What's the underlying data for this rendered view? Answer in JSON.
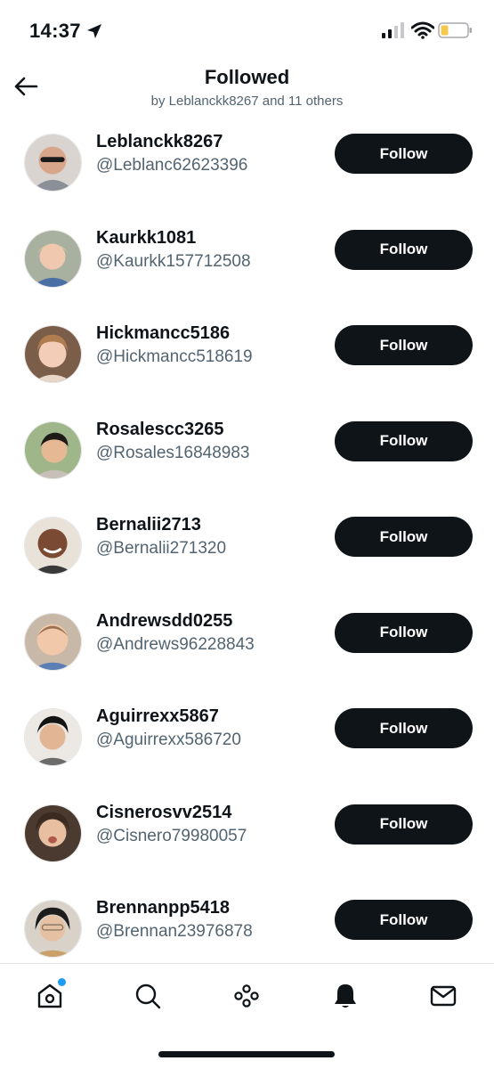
{
  "status_bar": {
    "time": "14:37",
    "icons": [
      "location-arrow-icon",
      "cellular-signal-icon",
      "wifi-icon",
      "battery-low-icon"
    ],
    "battery_color": "#f2c94c"
  },
  "header": {
    "back_icon": "arrow-left-icon",
    "title": "Followed",
    "subtitle": "by Leblanckk8267 and 11 others"
  },
  "users": [
    {
      "name": "Leblanckk8267",
      "handle": "@Leblanc62623396",
      "button": "Follow"
    },
    {
      "name": "Kaurkk1081",
      "handle": "@Kaurkk157712508",
      "button": "Follow"
    },
    {
      "name": "Hickmancc5186",
      "handle": "@Hickmancc518619",
      "button": "Follow"
    },
    {
      "name": "Rosalescc3265",
      "handle": "@Rosales16848983",
      "button": "Follow"
    },
    {
      "name": "Bernalii2713",
      "handle": "@Bernalii271320",
      "button": "Follow"
    },
    {
      "name": "Andrewsdd0255",
      "handle": "@Andrews96228843",
      "button": "Follow"
    },
    {
      "name": "Aguirrexx5867",
      "handle": "@Aguirrexx586720",
      "button": "Follow"
    },
    {
      "name": "Cisnerosvv2514",
      "handle": "@Cisnero79980057",
      "button": "Follow"
    },
    {
      "name": "Brennanpp5418",
      "handle": "@Brennan23976878",
      "button": "Follow"
    }
  ],
  "tab_bar": {
    "tabs": [
      "home-icon",
      "search-icon",
      "spaces-icon",
      "notifications-bell-icon",
      "messages-mail-icon"
    ],
    "active": "notifications-bell-icon",
    "notification_dot_color": "#1d9bf0"
  },
  "colors": {
    "text_primary": "#0f1419",
    "text_secondary": "#536471",
    "button_bg": "#0f1419",
    "button_text": "#ffffff"
  }
}
